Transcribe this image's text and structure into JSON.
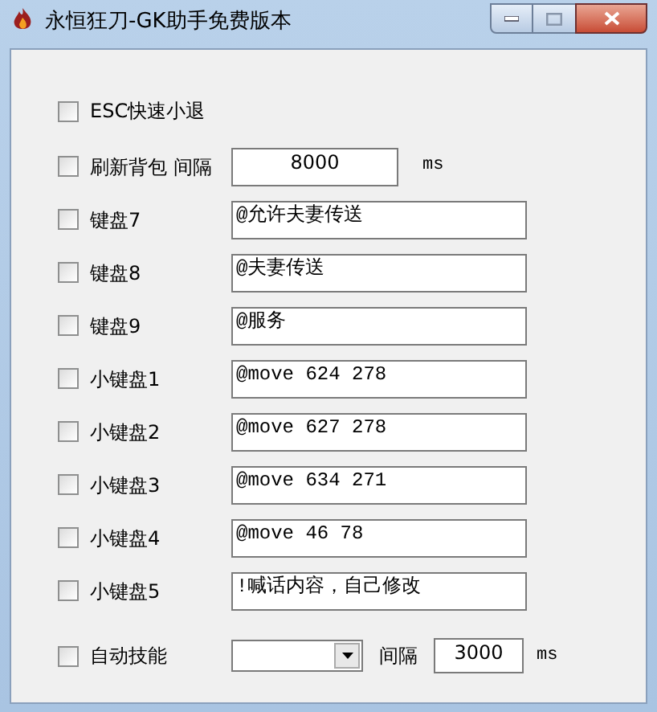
{
  "window": {
    "title": "永恒狂刀-GK助手免费版本"
  },
  "rows": [
    {
      "kind": "plain",
      "label": "ESC快速小退",
      "checked": false
    },
    {
      "kind": "interval",
      "label": "刷新背包 间隔",
      "checked": false,
      "value": "8000",
      "unit": "ms"
    },
    {
      "kind": "field",
      "label": "键盘7",
      "checked": false,
      "value": "@允许夫妻传送"
    },
    {
      "kind": "field",
      "label": "键盘8",
      "checked": false,
      "value": "@夫妻传送"
    },
    {
      "kind": "field",
      "label": "键盘9",
      "checked": false,
      "value": "@服务"
    },
    {
      "kind": "field",
      "label": "小键盘1",
      "checked": false,
      "value": "@move 624 278"
    },
    {
      "kind": "field",
      "label": "小键盘2",
      "checked": false,
      "value": "@move 627 278"
    },
    {
      "kind": "field",
      "label": "小键盘3",
      "checked": false,
      "value": "@move 634 271"
    },
    {
      "kind": "field",
      "label": "小键盘4",
      "checked": false,
      "value": "@move 46 78"
    },
    {
      "kind": "field",
      "label": "小键盘5",
      "checked": false,
      "value": "!喊话内容，自己修改"
    },
    {
      "kind": "skill",
      "label": "自动技能",
      "checked": false,
      "interval_label": "间隔",
      "value": "3000",
      "unit": "ms"
    }
  ]
}
